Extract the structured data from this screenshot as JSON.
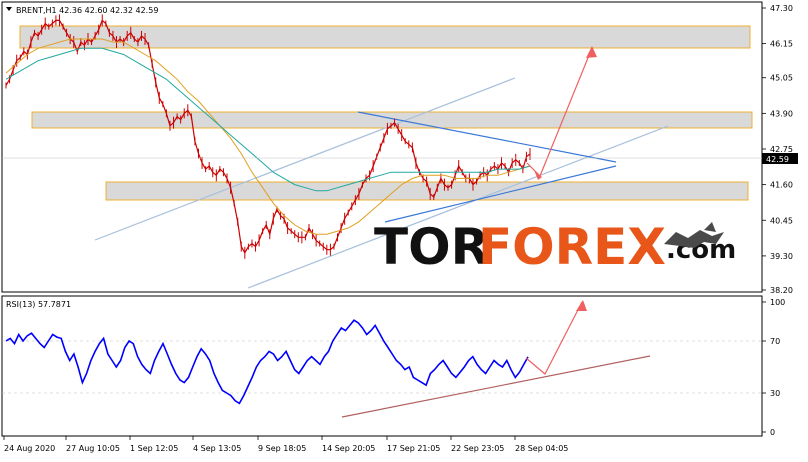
{
  "colors": {
    "candles": "#cc0000",
    "ma_fast": "#e0a020",
    "ma_slow": "#20a8a0",
    "channel": "#a8c0dc",
    "triangle": "#3a78d8",
    "zone_fill": "#d9d9d9",
    "zone_border": "#f0b030",
    "arrow": "#f06060",
    "rsi_line": "#0000ff",
    "rsi_trend": "#b06060",
    "price_tag": "#000000",
    "brand_tor": "#111111",
    "brand_forex": "#e8561a"
  },
  "chart_data": [
    {
      "type": "line",
      "panel": "price",
      "title": "BRENT,H1  42.36 42.60 42.32 42.59",
      "last_price_label": "42.59",
      "y_ticks": [
        "47.30",
        "46.15",
        "45.05",
        "43.90",
        "42.75",
        "41.60",
        "40.45",
        "39.30",
        "38.20"
      ],
      "ylim": [
        38.2,
        47.3
      ],
      "x_ticks": [
        "24 Aug 2020",
        "27 Aug 10:05",
        "1 Sep 12:05",
        "4 Sep 13:05",
        "9 Sep 18:05",
        "14 Sep 20:05",
        "17 Sep 21:05",
        "22 Sep 23:05",
        "28 Sep 04:05"
      ],
      "series": [
        {
          "values": [
            44.8,
            45.0,
            45.3,
            45.6,
            45.7,
            45.9,
            45.8,
            46.2,
            46.5,
            46.4,
            46.6,
            46.8,
            46.7,
            46.8,
            46.9,
            46.9,
            46.7,
            46.5,
            46.3,
            46.2,
            45.9,
            46.2,
            46.1,
            46.3,
            46.2,
            46.4,
            46.6,
            46.9,
            46.8,
            46.5,
            46.4,
            46.2,
            46.3,
            46.2,
            46.4,
            46.5,
            46.3,
            46.2,
            46.4,
            46.3,
            46.1,
            45.5,
            44.9,
            44.4,
            44.2,
            43.9,
            43.5,
            43.6,
            43.8,
            43.7,
            43.9,
            44.0,
            43.8,
            43.0,
            42.6,
            42.3,
            42.1,
            42.2,
            42.0,
            41.9,
            42.1,
            42.0,
            41.8,
            41.5,
            41.0,
            40.4,
            39.6,
            39.4,
            39.6,
            39.7,
            39.6,
            39.8,
            40.1,
            40.3,
            40.0,
            40.5,
            40.8,
            40.6,
            40.5,
            40.2,
            40.1,
            40.0,
            39.9,
            39.9,
            39.9,
            40.2,
            40.0,
            39.8,
            39.7,
            39.6,
            39.5,
            39.5,
            39.6,
            39.9,
            40.2,
            40.5,
            40.7,
            40.9,
            41.1,
            41.3,
            41.6,
            41.8,
            41.9,
            42.2,
            42.5,
            42.8,
            43.1,
            43.4,
            43.5,
            43.6,
            43.4,
            43.2,
            43.0,
            42.9,
            42.8,
            42.3,
            42.0,
            41.8,
            41.7,
            41.3,
            41.2,
            41.5,
            41.8,
            41.6,
            41.5,
            41.6,
            41.9,
            42.2,
            42.0,
            41.8,
            41.8,
            41.6,
            41.7,
            41.9,
            42.0,
            41.9,
            42.1,
            42.2,
            42.1,
            42.3,
            42.2,
            42.0,
            42.3,
            42.4,
            42.3,
            42.1,
            42.5,
            42.59
          ]
        },
        {
          "name": "",
          "values": [
            45.2,
            45.5,
            45.8,
            46.0,
            46.1,
            46.2,
            46.3,
            46.3,
            46.3,
            46.3,
            46.2,
            46.2,
            46.0,
            45.8,
            45.6,
            45.3,
            45.0,
            44.6,
            44.3,
            43.9,
            43.5,
            43.1,
            42.6,
            42.0,
            41.5,
            41.0,
            40.6,
            40.3,
            40.1,
            40.0,
            40.0,
            40.1,
            40.2,
            40.4,
            40.7,
            41.0,
            41.3,
            41.6,
            41.8,
            41.9,
            41.9,
            41.9,
            41.8,
            41.8,
            41.8,
            41.9,
            41.9,
            42.0,
            42.1,
            42.2
          ]
        },
        {
          "name": "",
          "values": [
            45.0,
            45.2,
            45.4,
            45.6,
            45.7,
            45.8,
            45.9,
            46.0,
            46.0,
            46.0,
            45.9,
            45.8,
            45.6,
            45.4,
            45.2,
            45.0,
            44.7,
            44.4,
            44.1,
            43.8,
            43.5,
            43.2,
            42.9,
            42.6,
            42.3,
            42.0,
            41.8,
            41.6,
            41.5,
            41.4,
            41.4,
            41.5,
            41.6,
            41.7,
            41.8,
            41.9,
            42.0,
            42.0,
            42.0,
            42.0,
            42.0,
            42.0,
            42.0,
            42.0,
            42.0,
            42.0,
            42.1,
            42.1,
            42.1,
            42.2
          ]
        }
      ]
    },
    {
      "type": "line",
      "panel": "rsi",
      "title": "RSI(13) 57.7871",
      "y_ticks": [
        "100",
        "70",
        "30",
        "0"
      ],
      "ylim": [
        0,
        100
      ],
      "series": [
        {
          "values": [
            70,
            72,
            68,
            75,
            70,
            74,
            76,
            72,
            68,
            65,
            70,
            75,
            73,
            72,
            62,
            55,
            60,
            50,
            38,
            45,
            55,
            62,
            68,
            72,
            60,
            55,
            50,
            55,
            65,
            70,
            68,
            58,
            52,
            48,
            45,
            55,
            62,
            68,
            60,
            52,
            45,
            40,
            38,
            42,
            50,
            58,
            64,
            60,
            55,
            45,
            38,
            32,
            30,
            28,
            24,
            22,
            28,
            35,
            42,
            50,
            55,
            58,
            62,
            60,
            55,
            58,
            62,
            55,
            48,
            45,
            50,
            55,
            58,
            55,
            52,
            58,
            62,
            70,
            75,
            80,
            78,
            82,
            86,
            84,
            80,
            75,
            78,
            82,
            76,
            70,
            65,
            60,
            55,
            52,
            48,
            50,
            42,
            40,
            38,
            36,
            45,
            48,
            52,
            55,
            50,
            45,
            42,
            46,
            50,
            55,
            58,
            52,
            48,
            45,
            50,
            55,
            52,
            50,
            55,
            48,
            42,
            46,
            52,
            57.8
          ]
        }
      ]
    }
  ],
  "brand": {
    "tor": "TOR",
    "forex": "FOREX",
    "com": ".com"
  }
}
